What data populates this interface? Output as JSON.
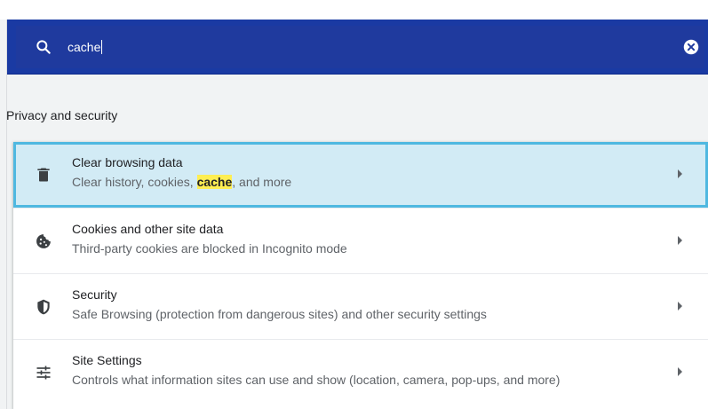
{
  "search": {
    "value": "cache",
    "icon": "search-icon",
    "clear_icon": "clear-search-icon"
  },
  "section": {
    "title": "Privacy and security"
  },
  "rows": [
    {
      "title": "Clear browsing data",
      "subtitle_before": "Clear history, cookies, ",
      "subtitle_match": "cache",
      "subtitle_after": ", and more",
      "icon": "trash-icon"
    },
    {
      "title": "Cookies and other site data",
      "subtitle": "Third-party cookies are blocked in Incognito mode",
      "icon": "cookie-icon"
    },
    {
      "title": "Security",
      "subtitle": "Safe Browsing (protection from dangerous sites) and other security settings",
      "icon": "shield-icon"
    },
    {
      "title": "Site Settings",
      "subtitle": "Controls what information sites can use and show (location, camera, pop-ups, and more)",
      "icon": "tune-icon"
    }
  ],
  "colors": {
    "header_bg": "#1a3aa3",
    "highlight_bg": "#d2ebf5",
    "highlight_border": "#4fb8e0",
    "match_bg": "#ffee52"
  }
}
